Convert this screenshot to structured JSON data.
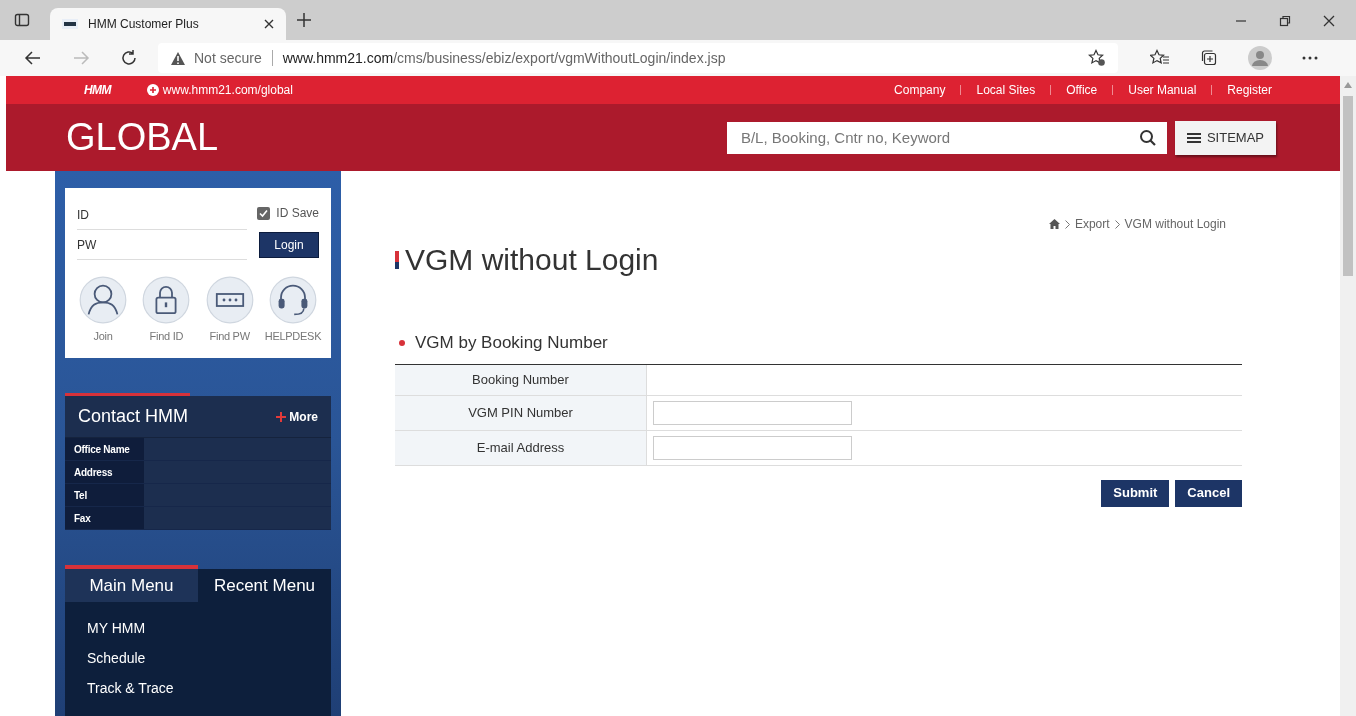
{
  "browser": {
    "tabs": [
      {
        "title": "HMM Customer Plus",
        "selected": true
      }
    ],
    "address": {
      "security": "Not secure",
      "host": "www.hmm21.com",
      "path": "/cms/business/ebiz/export/vgmWithoutLogin/index.jsp"
    }
  },
  "top_bar": {
    "logo": "HMM",
    "global_link": "www.hmm21.com/global",
    "links": [
      "Company",
      "Local Sites",
      "Office",
      "User Manual",
      "Register"
    ]
  },
  "header": {
    "title": "GLOBAL",
    "search_placeholder": "B/L, Booking, Cntr no, Keyword",
    "sitemap": "SITEMAP"
  },
  "login": {
    "id_placeholder": "ID",
    "pw_placeholder": "PW",
    "id_save": {
      "label": "ID Save",
      "checked": true
    },
    "login_button": "Login",
    "quick_links": [
      {
        "kind": "person",
        "label": "Join"
      },
      {
        "kind": "lock",
        "label": "Find ID"
      },
      {
        "kind": "password",
        "label": "Find PW"
      },
      {
        "kind": "headset",
        "label": "HELPDESK"
      }
    ]
  },
  "contact": {
    "title": "Contact HMM",
    "more": "More",
    "rows": [
      "Office Name",
      "Address",
      "Tel",
      "Fax"
    ]
  },
  "menu": {
    "tabs": [
      {
        "label": "Main Menu",
        "selected": true
      },
      {
        "label": "Recent Menu",
        "selected": false
      }
    ],
    "items": [
      "MY HMM",
      "Schedule",
      "Track & Trace"
    ]
  },
  "main": {
    "breadcrumb": [
      "Export",
      "VGM without Login"
    ],
    "title": "VGM without Login",
    "section": "VGM by Booking Number",
    "rows": [
      {
        "label": "Booking Number",
        "kind": "text"
      },
      {
        "label": "VGM PIN Number",
        "kind": "input"
      },
      {
        "label": "E-mail Address",
        "kind": "input"
      }
    ],
    "buttons": [
      "Submit",
      "Cancel"
    ]
  }
}
